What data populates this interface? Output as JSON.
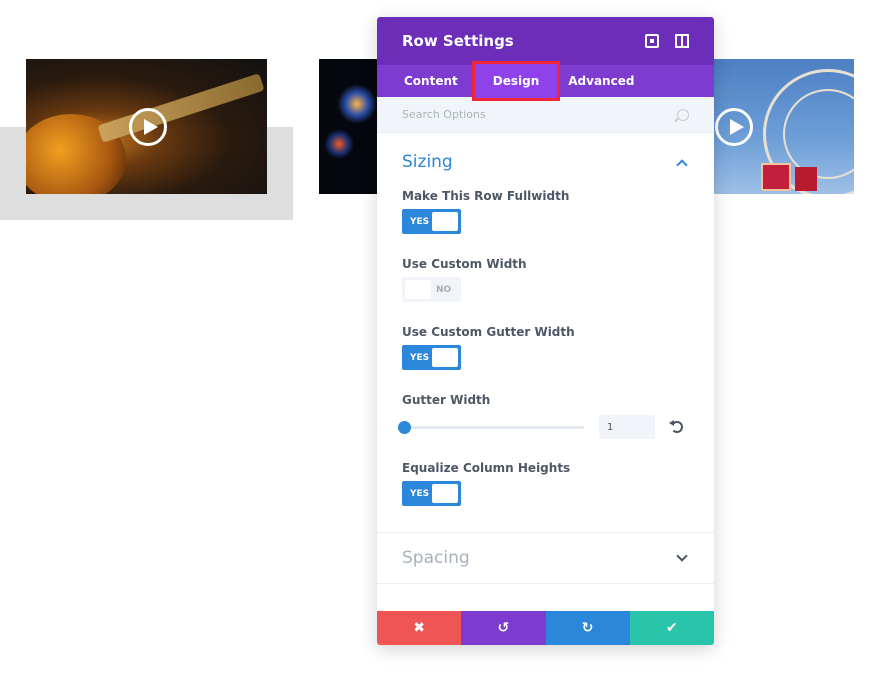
{
  "modal": {
    "title": "Row Settings",
    "header_icons": [
      "expand-icon",
      "split-view-icon"
    ]
  },
  "tabs": [
    {
      "label": "Content",
      "active": false
    },
    {
      "label": "Design",
      "active": true
    },
    {
      "label": "Advanced",
      "active": false
    }
  ],
  "search": {
    "placeholder": "Search Options"
  },
  "sections": {
    "sizing": {
      "title": "Sizing",
      "expanded": true,
      "fields": {
        "fullwidth": {
          "label": "Make This Row Fullwidth",
          "value": "YES"
        },
        "custom_width": {
          "label": "Use Custom Width",
          "value": "NO"
        },
        "custom_gutter": {
          "label": "Use Custom Gutter Width",
          "value": "YES"
        },
        "gutter_width": {
          "label": "Gutter Width",
          "value": "1"
        },
        "equalize": {
          "label": "Equalize Column Heights",
          "value": "YES"
        }
      }
    },
    "spacing": {
      "title": "Spacing",
      "expanded": false
    }
  },
  "footer": {
    "cancel_icon": "✖",
    "undo_icon": "↺",
    "redo_icon": "↻",
    "save_icon": "✔"
  },
  "colors": {
    "header": "#6c2eb9",
    "tabs": "#7e3bd0",
    "active_tab": "#8f42ec",
    "highlight": "#f0253a",
    "accent_blue": "#2b87da",
    "cancel": "#ef5555",
    "save": "#29c4a9"
  }
}
